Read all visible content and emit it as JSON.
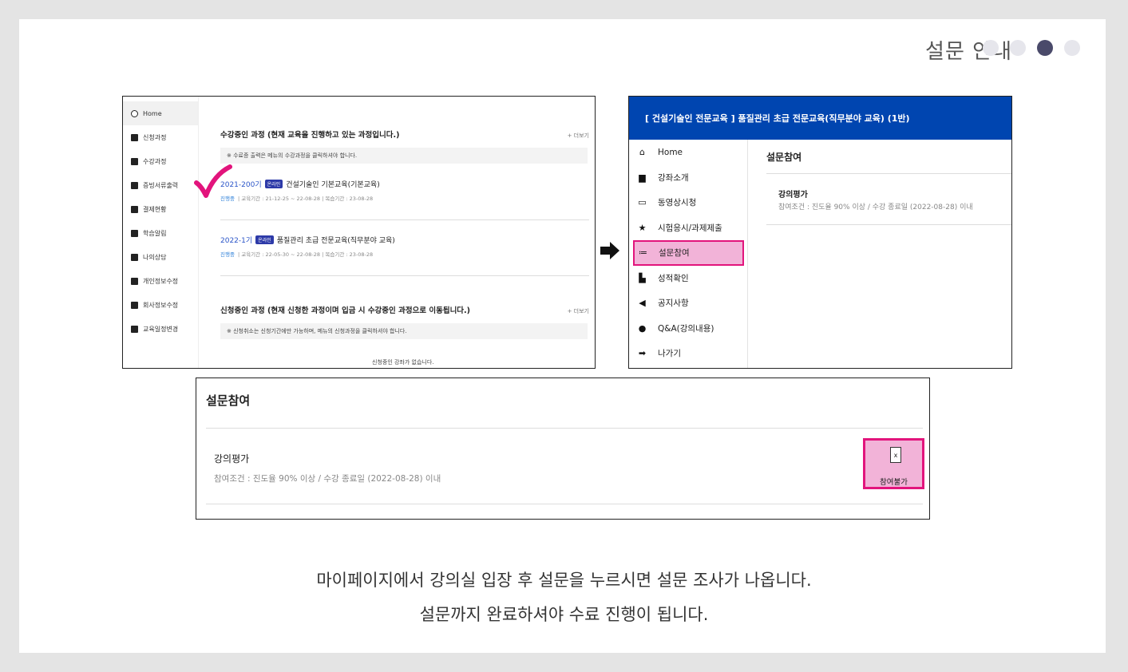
{
  "guide": {
    "title": "설문 안내",
    "dots": 4,
    "active_dot": 3
  },
  "colors": {
    "header_blue": "#0045b0",
    "highlight_pink": "#f2b3d8",
    "highlight_border": "#e2147c",
    "active_dot": "#4a4a6a"
  },
  "shotA": {
    "sidebar": [
      {
        "label": "Home",
        "icon": "home-circle-icon"
      },
      {
        "label": "신청과정",
        "icon": "pen-icon"
      },
      {
        "label": "수강과정",
        "icon": "book-icon"
      },
      {
        "label": "증빙서류출력",
        "icon": "print-icon"
      },
      {
        "label": "결제현황",
        "icon": "receipt-icon"
      },
      {
        "label": "학습알림",
        "icon": "bell-icon"
      },
      {
        "label": "나의상담",
        "icon": "people-icon"
      },
      {
        "label": "개인정보수정",
        "icon": "user-doc-icon"
      },
      {
        "label": "회사정보수정",
        "icon": "company-doc-icon"
      },
      {
        "label": "교육일정변경",
        "icon": "calendar-edit-icon"
      }
    ],
    "section1": {
      "title": "수강중인 과정 (현재 교육을 진행하고 있는 과정입니다.)",
      "more": "+ 더보기",
      "notice": "※ 수료증 출력은 메뉴의 수강과정을 클릭하셔야 합니다."
    },
    "courses": [
      {
        "code": "2021-200기",
        "badge": "온라인",
        "name": "건설기술인 기본교육(기본교육)",
        "status": "진행중",
        "period": "교육기간 : 21-12-25 ~ 22-08-28",
        "review": "복습기간 : 23-08-28"
      },
      {
        "code": "2022-1기",
        "badge": "온라인",
        "name": "품질관리 초급 전문교육(직무분야 교육)",
        "status": "진행중",
        "period": "교육기간 : 22-05-30 ~ 22-08-28",
        "review": "복습기간 : 23-08-28"
      }
    ],
    "section2": {
      "title": "신청중인 과정 (현재 신청한 과정이며 입금 시 수강중인 과정으로 이동됩니다.)",
      "more": "+ 더보기",
      "notice": "※ 신청취소는 신청기간에만 가능하며, 메뉴의 신청과정을 클릭하셔야 합니다.",
      "empty": "신청중인 강좌가 없습니다."
    }
  },
  "shotB": {
    "header": "[ 건설기술인 전문교육 ] 품질관리 초급 전문교육(직무분야 교육) (1반)",
    "menu": [
      {
        "label": "Home",
        "icon": "home-icon",
        "glyph": "⌂"
      },
      {
        "label": "강좌소개",
        "icon": "book-icon",
        "glyph": "▆"
      },
      {
        "label": "동영상시청",
        "icon": "monitor-icon",
        "glyph": "▭"
      },
      {
        "label": "시험응시/과제제출",
        "icon": "star-icon",
        "glyph": "★"
      },
      {
        "label": "설문참여",
        "icon": "list-icon",
        "glyph": "≔"
      },
      {
        "label": "성적확인",
        "icon": "chart-icon",
        "glyph": "▙"
      },
      {
        "label": "공지사항",
        "icon": "megaphone-icon",
        "glyph": "◀"
      },
      {
        "label": "Q&A(강의내용)",
        "icon": "chat-icon",
        "glyph": "●"
      },
      {
        "label": "나가기",
        "icon": "exit-icon",
        "glyph": "➡"
      }
    ],
    "selected_index": 4,
    "main_title": "설문참여",
    "survey_name": "강의평가",
    "condition": "참여조건 : 진도율 90% 이상 / 수강 종료일 (2022-08-28) 이내"
  },
  "shotC": {
    "title": "설문참여",
    "survey_name": "강의평가",
    "condition": "참여조건 : 진도율 90% 이상 / 수강 종료일 (2022-08-28) 이내",
    "button_icon": "x",
    "button_label": "참여불가"
  },
  "caption": {
    "line1": "마이페이지에서 강의실 입장 후 설문을 누르시면 설문 조사가 나옵니다.",
    "line2": "설문까지 완료하셔야 수료 진행이 됩니다."
  }
}
